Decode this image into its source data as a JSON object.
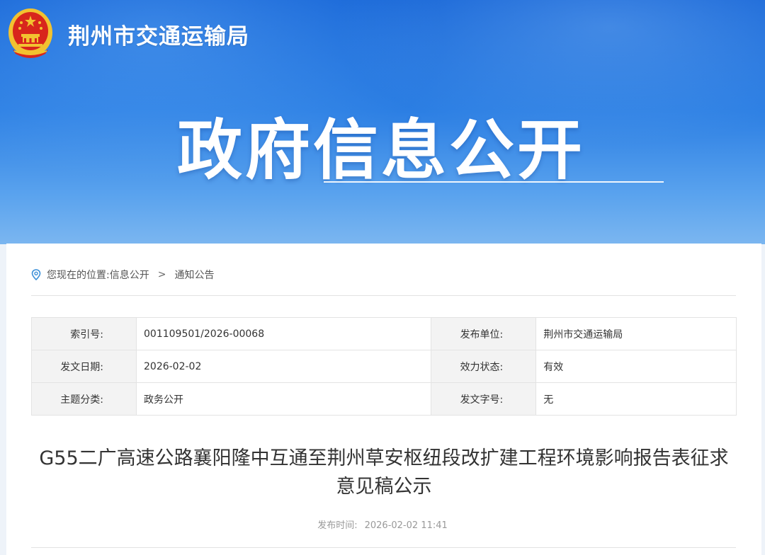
{
  "header": {
    "site_name": "荆州市交通运输局",
    "hero_title": "政府信息公开"
  },
  "breadcrumb": {
    "prefix": "您现在的位置:",
    "items": [
      "信息公开",
      "通知公告"
    ],
    "separator": ">"
  },
  "meta": {
    "rows": [
      {
        "label1": "索引号:",
        "value1": "001109501/2026-00068",
        "label2": "发布单位:",
        "value2": "荆州市交通运输局"
      },
      {
        "label1": "发文日期:",
        "value1": "2026-02-02",
        "label2": "效力状态:",
        "value2": "有效"
      },
      {
        "label1": "主题分类:",
        "value1": "政务公开",
        "label2": "发文字号:",
        "value2": "无"
      }
    ]
  },
  "article": {
    "title": "G55二广高速公路襄阳隆中互通至荆州草安枢纽段改扩建工程环境影响报告表征求意见稿公示",
    "publish_label": "发布时间:",
    "publish_time": "2026-02-02 11:41"
  },
  "colors": {
    "banner_top": "#1463d6",
    "banner_bottom": "#7bb6f0",
    "emblem_red": "#d8261c",
    "emblem_gold": "#f2c230"
  }
}
